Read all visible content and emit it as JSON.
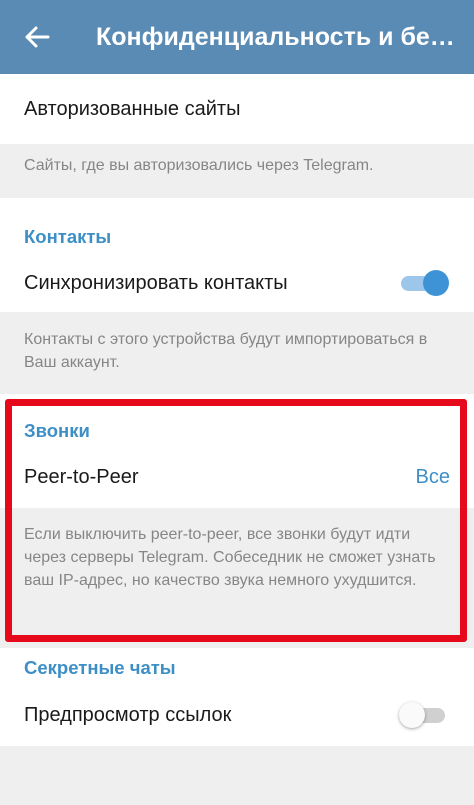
{
  "appbar": {
    "title": "Конфиденциальность и бе…",
    "back_icon": "arrow-left-icon",
    "color": "#5a8bb5"
  },
  "authorized_sites": {
    "label": "Авторизованные сайты",
    "hint": "Сайты, где вы авторизовались через Telegram."
  },
  "contacts": {
    "header": "Контакты",
    "sync_label": "Синхронизировать контакты",
    "sync_enabled": true,
    "hint": "Контакты с этого устройства будут импортироваться в Ваш аккаунт."
  },
  "calls": {
    "header": "Звонки",
    "p2p_label": "Peer-to-Peer",
    "p2p_value": "Все",
    "hint": "Если выключить peer-to-peer, все звонки будут идти через серверы Telegram. Собеседник не сможет узнать ваш IP-адрес, но качество звука немного ухудшится."
  },
  "secret_chats": {
    "header": "Секретные чаты",
    "link_preview_label": "Предпросмотр ссылок",
    "link_preview_enabled": false
  },
  "colors": {
    "accent": "#3d8fc6",
    "highlight_border": "#e5091b",
    "background": "#efefef"
  }
}
